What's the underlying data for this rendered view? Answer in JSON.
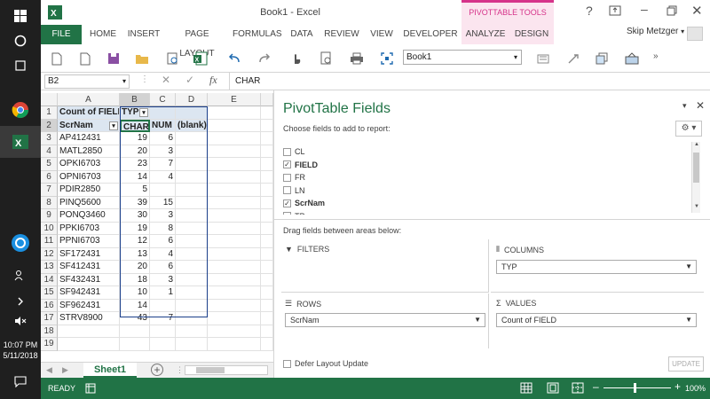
{
  "taskbar": {
    "time": "10:07 PM",
    "date": "5/11/2018"
  },
  "titlebar": {
    "title": "Book1 - Excel",
    "context_group": "PIVOTTABLE TOOLS",
    "user": "Skip Metzger"
  },
  "ribbon": {
    "tabs": [
      "FILE",
      "HOME",
      "INSERT",
      "PAGE LAYOUT",
      "FORMULAS",
      "DATA",
      "REVIEW",
      "VIEW",
      "DEVELOPER",
      "ANALYZE",
      "DESIGN"
    ],
    "workbook_dropdown": "Book1"
  },
  "formula_bar": {
    "name_box": "B2",
    "content": "CHAR"
  },
  "grid": {
    "columns": [
      "A",
      "B",
      "C",
      "D",
      "E"
    ],
    "row_numbers": [
      "1",
      "2",
      "3",
      "4",
      "5",
      "6",
      "7",
      "8",
      "9",
      "10",
      "11",
      "12",
      "13",
      "14",
      "15",
      "16",
      "17",
      "18",
      "19"
    ],
    "pivot_header": {
      "a1": "Count of FIELD",
      "b1": "TYP",
      "a2": "ScrNam",
      "b2": "CHAR",
      "c2": "NUM",
      "d2": "(blank)"
    },
    "rows": [
      {
        "name": "AP412431",
        "char": "19",
        "num": "6"
      },
      {
        "name": "MATL2850",
        "char": "20",
        "num": "3"
      },
      {
        "name": "OPKI6703",
        "char": "23",
        "num": "7"
      },
      {
        "name": "OPNI6703",
        "char": "14",
        "num": "4"
      },
      {
        "name": "PDIR2850",
        "char": "5",
        "num": ""
      },
      {
        "name": "PINQ5600",
        "char": "39",
        "num": "15"
      },
      {
        "name": "PONQ3460",
        "char": "30",
        "num": "3"
      },
      {
        "name": "PPKI6703",
        "char": "19",
        "num": "8"
      },
      {
        "name": "PPNI6703",
        "char": "12",
        "num": "6"
      },
      {
        "name": "SF172431",
        "char": "13",
        "num": "4"
      },
      {
        "name": "SF412431",
        "char": "20",
        "num": "6"
      },
      {
        "name": "SF432431",
        "char": "18",
        "num": "3"
      },
      {
        "name": "SF942431",
        "char": "10",
        "num": "1"
      },
      {
        "name": "SF962431",
        "char": "14",
        "num": ""
      },
      {
        "name": "STRV8900",
        "char": "43",
        "num": "7"
      }
    ],
    "sheet_tab": "Sheet1"
  },
  "pivot_pane": {
    "title": "PivotTable Fields",
    "choose_label": "Choose fields to add to report:",
    "fields": [
      {
        "label": "CL",
        "checked": false
      },
      {
        "label": "FIELD",
        "checked": true
      },
      {
        "label": "FR",
        "checked": false
      },
      {
        "label": "LN",
        "checked": false
      },
      {
        "label": "ScrNam",
        "checked": true
      },
      {
        "label": "TP",
        "checked": false
      }
    ],
    "drag_label": "Drag fields between areas below:",
    "filters_label": "FILTERS",
    "columns_label": "COLUMNS",
    "columns_value": "TYP",
    "rows_label": "ROWS",
    "rows_value": "ScrNam",
    "values_label": "VALUES",
    "values_value": "Count of FIELD",
    "defer_label": "Defer Layout Update",
    "update_label": "UPDATE"
  },
  "status": {
    "ready": "READY",
    "zoom": "100%"
  },
  "colors": {
    "excel_green": "#217346",
    "pivot_blue": "#dce6f1",
    "context_pink": "#d6338a"
  }
}
